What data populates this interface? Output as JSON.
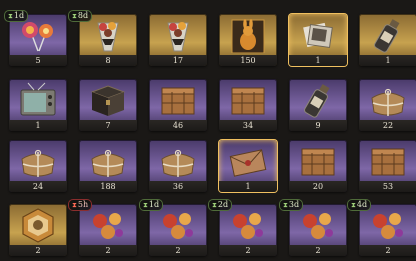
{
  "colors": {
    "gold": "#c7a24f",
    "purple": "#7e67a7",
    "blue": "#5d7fa3",
    "gray": "#88827b",
    "timer_green": "#4f6b3a",
    "timer_red": "#8a2d2d"
  },
  "timers": [
    {
      "label": "1d",
      "urgent": false
    },
    {
      "label": "8d",
      "urgent": false
    },
    {
      "label": "5h",
      "urgent": true
    },
    {
      "label": "1d",
      "urgent": false
    },
    {
      "label": "2d",
      "urgent": false
    },
    {
      "label": "3d",
      "urgent": false
    },
    {
      "label": "4d",
      "urgent": false
    }
  ],
  "items": [
    {
      "icon": "candy-lollipops-icon",
      "count": "5",
      "rarity": "purple"
    },
    {
      "icon": "candy-bouquet-icon",
      "count": "8",
      "rarity": "gold"
    },
    {
      "icon": "candy-bouquet-icon",
      "count": "17",
      "rarity": "gold"
    },
    {
      "icon": "golden-rabbit-figure-icon",
      "count": "150",
      "rarity": "gold"
    },
    {
      "icon": "photo-bundle-icon",
      "count": "1",
      "rarity": "gold"
    },
    {
      "icon": "bottle-icon",
      "count": "1",
      "rarity": "gold"
    },
    {
      "icon": "tv-set-icon",
      "count": "1",
      "rarity": "purple"
    },
    {
      "icon": "dark-chest-icon",
      "count": "7",
      "rarity": "purple"
    },
    {
      "icon": "wooden-crate-icon",
      "count": "46",
      "rarity": "purple"
    },
    {
      "icon": "wooden-crate-icon",
      "count": "34",
      "rarity": "purple"
    },
    {
      "icon": "bottle-icon",
      "count": "9",
      "rarity": "purple"
    },
    {
      "icon": "parcel-icon",
      "count": "22",
      "rarity": "purple"
    },
    {
      "icon": "parcel-icon",
      "count": "24",
      "rarity": "purple"
    },
    {
      "icon": "parcel-icon",
      "count": "188",
      "rarity": "purple"
    },
    {
      "icon": "parcel-icon",
      "count": "36",
      "rarity": "purple"
    },
    {
      "icon": "envelope-icon",
      "count": "1",
      "rarity": "purple"
    },
    {
      "icon": "wooden-crate-icon",
      "count": "20",
      "rarity": "purple"
    },
    {
      "icon": "wooden-crate-icon",
      "count": "53",
      "rarity": "purple"
    },
    {
      "icon": "hexagon-emblem-icon",
      "count": "2",
      "rarity": "gold"
    },
    {
      "icon": "candy-mix-icon",
      "count": "2",
      "rarity": "purple"
    },
    {
      "icon": "candy-mix-icon",
      "count": "2",
      "rarity": "purple"
    },
    {
      "icon": "candy-mix-icon",
      "count": "2",
      "rarity": "purple"
    },
    {
      "icon": "candy-mix-icon",
      "count": "2",
      "rarity": "purple"
    },
    {
      "icon": "candy-mix-icon",
      "count": "2",
      "rarity": "purple"
    }
  ]
}
